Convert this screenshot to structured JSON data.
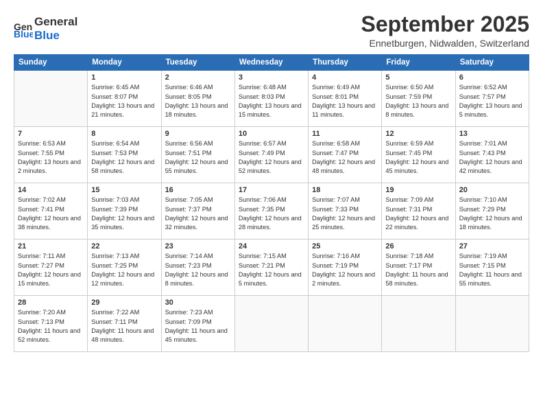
{
  "header": {
    "logo_line1": "General",
    "logo_line2": "Blue",
    "month_title": "September 2025",
    "subtitle": "Ennetburgen, Nidwalden, Switzerland"
  },
  "days_of_week": [
    "Sunday",
    "Monday",
    "Tuesday",
    "Wednesday",
    "Thursday",
    "Friday",
    "Saturday"
  ],
  "weeks": [
    [
      {
        "day": "",
        "info": ""
      },
      {
        "day": "1",
        "info": "Sunrise: 6:45 AM\nSunset: 8:07 PM\nDaylight: 13 hours\nand 21 minutes."
      },
      {
        "day": "2",
        "info": "Sunrise: 6:46 AM\nSunset: 8:05 PM\nDaylight: 13 hours\nand 18 minutes."
      },
      {
        "day": "3",
        "info": "Sunrise: 6:48 AM\nSunset: 8:03 PM\nDaylight: 13 hours\nand 15 minutes."
      },
      {
        "day": "4",
        "info": "Sunrise: 6:49 AM\nSunset: 8:01 PM\nDaylight: 13 hours\nand 11 minutes."
      },
      {
        "day": "5",
        "info": "Sunrise: 6:50 AM\nSunset: 7:59 PM\nDaylight: 13 hours\nand 8 minutes."
      },
      {
        "day": "6",
        "info": "Sunrise: 6:52 AM\nSunset: 7:57 PM\nDaylight: 13 hours\nand 5 minutes."
      }
    ],
    [
      {
        "day": "7",
        "info": "Sunrise: 6:53 AM\nSunset: 7:55 PM\nDaylight: 13 hours\nand 2 minutes."
      },
      {
        "day": "8",
        "info": "Sunrise: 6:54 AM\nSunset: 7:53 PM\nDaylight: 12 hours\nand 58 minutes."
      },
      {
        "day": "9",
        "info": "Sunrise: 6:56 AM\nSunset: 7:51 PM\nDaylight: 12 hours\nand 55 minutes."
      },
      {
        "day": "10",
        "info": "Sunrise: 6:57 AM\nSunset: 7:49 PM\nDaylight: 12 hours\nand 52 minutes."
      },
      {
        "day": "11",
        "info": "Sunrise: 6:58 AM\nSunset: 7:47 PM\nDaylight: 12 hours\nand 48 minutes."
      },
      {
        "day": "12",
        "info": "Sunrise: 6:59 AM\nSunset: 7:45 PM\nDaylight: 12 hours\nand 45 minutes."
      },
      {
        "day": "13",
        "info": "Sunrise: 7:01 AM\nSunset: 7:43 PM\nDaylight: 12 hours\nand 42 minutes."
      }
    ],
    [
      {
        "day": "14",
        "info": "Sunrise: 7:02 AM\nSunset: 7:41 PM\nDaylight: 12 hours\nand 38 minutes."
      },
      {
        "day": "15",
        "info": "Sunrise: 7:03 AM\nSunset: 7:39 PM\nDaylight: 12 hours\nand 35 minutes."
      },
      {
        "day": "16",
        "info": "Sunrise: 7:05 AM\nSunset: 7:37 PM\nDaylight: 12 hours\nand 32 minutes."
      },
      {
        "day": "17",
        "info": "Sunrise: 7:06 AM\nSunset: 7:35 PM\nDaylight: 12 hours\nand 28 minutes."
      },
      {
        "day": "18",
        "info": "Sunrise: 7:07 AM\nSunset: 7:33 PM\nDaylight: 12 hours\nand 25 minutes."
      },
      {
        "day": "19",
        "info": "Sunrise: 7:09 AM\nSunset: 7:31 PM\nDaylight: 12 hours\nand 22 minutes."
      },
      {
        "day": "20",
        "info": "Sunrise: 7:10 AM\nSunset: 7:29 PM\nDaylight: 12 hours\nand 18 minutes."
      }
    ],
    [
      {
        "day": "21",
        "info": "Sunrise: 7:11 AM\nSunset: 7:27 PM\nDaylight: 12 hours\nand 15 minutes."
      },
      {
        "day": "22",
        "info": "Sunrise: 7:13 AM\nSunset: 7:25 PM\nDaylight: 12 hours\nand 12 minutes."
      },
      {
        "day": "23",
        "info": "Sunrise: 7:14 AM\nSunset: 7:23 PM\nDaylight: 12 hours\nand 8 minutes."
      },
      {
        "day": "24",
        "info": "Sunrise: 7:15 AM\nSunset: 7:21 PM\nDaylight: 12 hours\nand 5 minutes."
      },
      {
        "day": "25",
        "info": "Sunrise: 7:16 AM\nSunset: 7:19 PM\nDaylight: 12 hours\nand 2 minutes."
      },
      {
        "day": "26",
        "info": "Sunrise: 7:18 AM\nSunset: 7:17 PM\nDaylight: 11 hours\nand 58 minutes."
      },
      {
        "day": "27",
        "info": "Sunrise: 7:19 AM\nSunset: 7:15 PM\nDaylight: 11 hours\nand 55 minutes."
      }
    ],
    [
      {
        "day": "28",
        "info": "Sunrise: 7:20 AM\nSunset: 7:13 PM\nDaylight: 11 hours\nand 52 minutes."
      },
      {
        "day": "29",
        "info": "Sunrise: 7:22 AM\nSunset: 7:11 PM\nDaylight: 11 hours\nand 48 minutes."
      },
      {
        "day": "30",
        "info": "Sunrise: 7:23 AM\nSunset: 7:09 PM\nDaylight: 11 hours\nand 45 minutes."
      },
      {
        "day": "",
        "info": ""
      },
      {
        "day": "",
        "info": ""
      },
      {
        "day": "",
        "info": ""
      },
      {
        "day": "",
        "info": ""
      }
    ]
  ]
}
